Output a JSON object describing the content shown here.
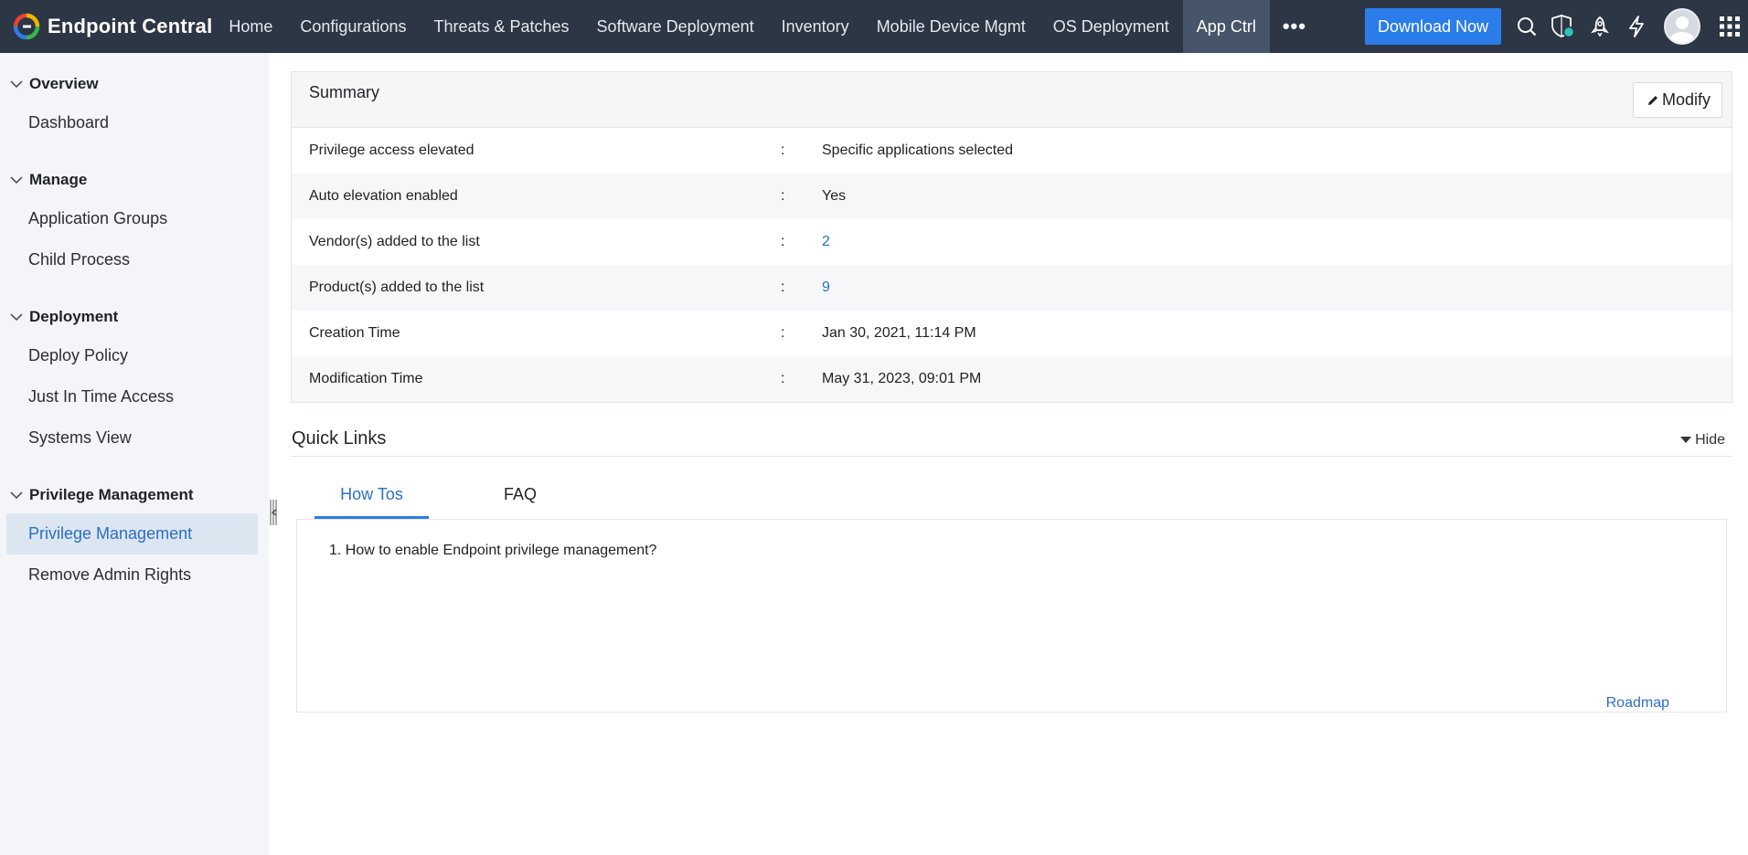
{
  "brand": {
    "name": "Endpoint Central",
    "colors": [
      "#e8432f",
      "#2b7de9",
      "#f7b500",
      "#39b54a"
    ]
  },
  "nav": {
    "items": [
      {
        "label": "Home"
      },
      {
        "label": "Configurations"
      },
      {
        "label": "Threats & Patches"
      },
      {
        "label": "Software Deployment"
      },
      {
        "label": "Inventory"
      },
      {
        "label": "Mobile Device Mgmt"
      },
      {
        "label": "OS Deployment"
      },
      {
        "label": "App Ctrl",
        "active": true
      }
    ],
    "more_label": "•••",
    "download_label": "Download Now",
    "icons": [
      "search-icon",
      "shield-status-icon",
      "rocket-icon",
      "lightning-icon",
      "avatar",
      "app-grid-icon"
    ]
  },
  "sidebar": {
    "sections": [
      {
        "heading": "Overview",
        "items": [
          {
            "label": "Dashboard"
          }
        ]
      },
      {
        "heading": "Manage",
        "items": [
          {
            "label": "Application Groups"
          },
          {
            "label": "Child Process"
          }
        ]
      },
      {
        "heading": "Deployment",
        "items": [
          {
            "label": "Deploy Policy"
          },
          {
            "label": "Just In Time Access"
          },
          {
            "label": "Systems View"
          }
        ]
      },
      {
        "heading": "Privilege Management",
        "items": [
          {
            "label": "Privilege Management",
            "active": true
          },
          {
            "label": "Remove Admin Rights"
          }
        ]
      }
    ]
  },
  "summary": {
    "title": "Summary",
    "modify_label": "Modify",
    "separator": ":",
    "rows": [
      {
        "key": "Privilege access elevated",
        "value": "Specific applications selected"
      },
      {
        "key": "Auto elevation enabled",
        "value": "Yes"
      },
      {
        "key": "Vendor(s) added to the list",
        "value": "2",
        "link": true
      },
      {
        "key": "Product(s) added to the list",
        "value": "9",
        "link": true
      },
      {
        "key": "Creation Time",
        "value": "Jan 30, 2021, 11:14 PM"
      },
      {
        "key": "Modification Time",
        "value": "May 31, 2023, 09:01 PM"
      }
    ]
  },
  "quick_links": {
    "title": "Quick Links",
    "hide_label": "Hide",
    "tabs": [
      {
        "label": "How Tos",
        "active": true
      },
      {
        "label": "FAQ"
      }
    ],
    "howtos": [
      "1. How to enable Endpoint privilege management?"
    ],
    "roadmap_label": "Roadmap"
  },
  "accent": "#2b7de9"
}
